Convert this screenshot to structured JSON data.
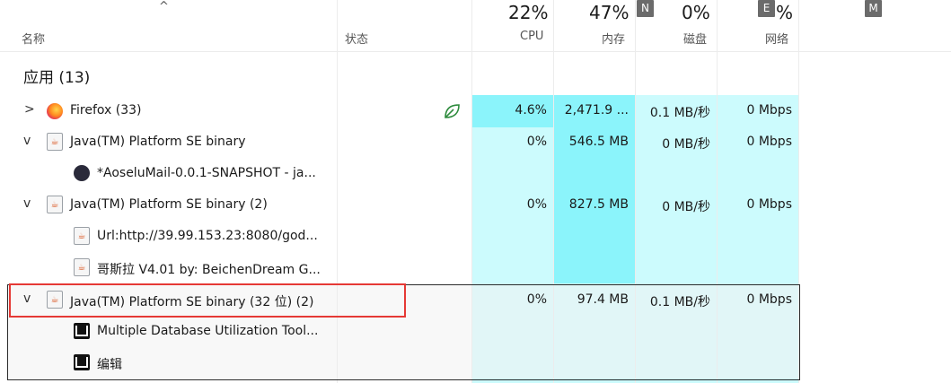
{
  "header": {
    "sort_arrow": "^",
    "columns": {
      "name": "名称",
      "status": "状态",
      "cpu": {
        "pct": "22%",
        "label": "CPU",
        "badge": ""
      },
      "memory": {
        "pct": "47%",
        "label": "内存",
        "badge": "N"
      },
      "disk": {
        "pct": "0%",
        "label": "磁盘",
        "badge": ""
      },
      "network": {
        "pct": "%",
        "label": "网络",
        "badge": "E"
      },
      "extra_badge": "M"
    }
  },
  "group": {
    "title": "应用 (13)"
  },
  "rows": [
    {
      "name": "Firefox (33)",
      "cpu": "4.6%",
      "memory": "2,471.9 ...",
      "disk": "0.1 MB/秒",
      "network": "0 Mbps",
      "expand": ">",
      "icon": "firefox-icon"
    },
    {
      "name": "Java(TM) Platform SE binary",
      "cpu": "0%",
      "memory": "546.5 MB",
      "disk": "0 MB/秒",
      "network": "0 Mbps",
      "expand": "v",
      "icon": "java-icon"
    },
    {
      "name": "*AoseluMail-0.0.1-SNAPSHOT - ja...",
      "icon": "avatar-icon"
    },
    {
      "name": "Java(TM) Platform SE binary (2)",
      "cpu": "0%",
      "memory": "827.5 MB",
      "disk": "0 MB/秒",
      "network": "0 Mbps",
      "expand": "v",
      "icon": "java-icon"
    },
    {
      "name": "Url:http://39.99.153.23:8080/god...",
      "icon": "java-icon"
    },
    {
      "name": "哥斯拉   V4.01 by: BeichenDream G...",
      "icon": "java-icon"
    },
    {
      "name": "Java(TM) Platform SE binary (32 位) (2)",
      "cpu": "0%",
      "memory": "97.4 MB",
      "disk": "0.1 MB/秒",
      "network": "0 Mbps",
      "expand": "v",
      "icon": "java-icon"
    },
    {
      "name": "Multiple Database Utilization Tool...",
      "icon": "document-icon"
    },
    {
      "name": "编辑",
      "icon": "document-icon"
    }
  ]
}
